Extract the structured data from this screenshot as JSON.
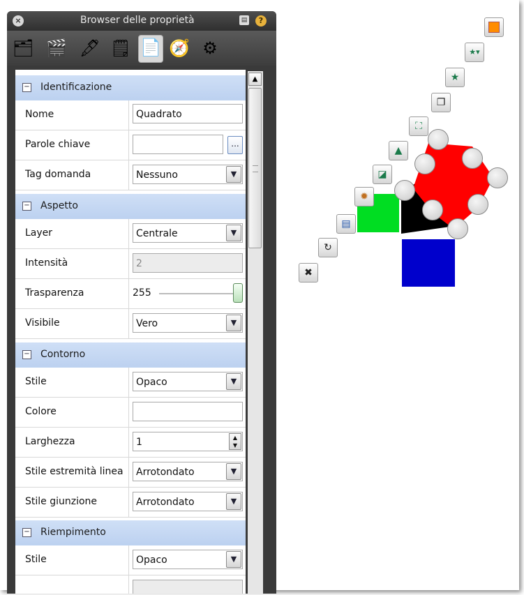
{
  "window": {
    "title": "Browser delle proprietà",
    "close_icon": "close-icon",
    "doc_icon": "document-icon",
    "help_icon": "help-icon"
  },
  "toolbar": {
    "tools": [
      "properties-page-icon",
      "gallery-icon",
      "objects-icon",
      "notes-icon",
      "property-sheet-icon",
      "tools-icon",
      "actions-icon"
    ],
    "active_index": 4
  },
  "sections": {
    "identificazione": {
      "title": "Identificazione",
      "nome_label": "Nome",
      "nome_value": "Quadrato",
      "parole_label": "Parole chiave",
      "parole_value": "",
      "parole_btn": "...",
      "tag_label": "Tag domanda",
      "tag_value": "Nessuno"
    },
    "aspetto": {
      "title": "Aspetto",
      "layer_label": "Layer",
      "layer_value": "Centrale",
      "intensita_label": "Intensità",
      "intensita_value": "2",
      "trasparenza_label": "Trasparenza",
      "trasparenza_value": "255",
      "visibile_label": "Visibile",
      "visibile_value": "Vero"
    },
    "contorno": {
      "title": "Contorno",
      "stile_label": "Stile",
      "stile_value": "Opaco",
      "colore_label": "Colore",
      "colore_value": "",
      "larghezza_label": "Larghezza",
      "larghezza_value": "1",
      "estremita_label": "Stile estremità linea",
      "estremita_value": "Arrotondato",
      "giunzione_label": "Stile giunzione",
      "giunzione_value": "Arrotondato"
    },
    "riempimento": {
      "title": "Riempimento",
      "stile_label": "Stile",
      "stile_value": "Opaco"
    }
  },
  "shape_colors": {
    "red": "#ff0000",
    "black": "#000000",
    "green": "#00dd22",
    "blue": "#0000cc"
  }
}
